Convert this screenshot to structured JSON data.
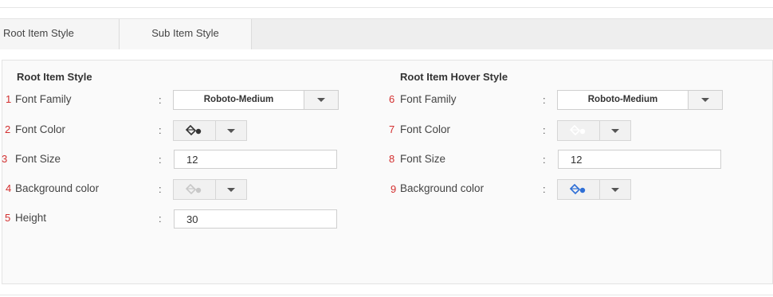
{
  "tabs": [
    {
      "label": "Root Item Style"
    },
    {
      "label": "Sub Item Style"
    }
  ],
  "root_style": {
    "title": "Root Item Style",
    "fields": [
      {
        "num": "1",
        "label": "Font Family",
        "value": "Roboto-Medium"
      },
      {
        "num": "2",
        "label": "Font Color",
        "color": "#333333"
      },
      {
        "num": "3",
        "label": "Font Size",
        "value": "12"
      },
      {
        "num": "4",
        "label": "Background color",
        "color": "#c8c8c8"
      },
      {
        "num": "5",
        "label": "Height",
        "value": "30"
      }
    ]
  },
  "hover_style": {
    "title": "Root Item Hover Style",
    "fields": [
      {
        "num": "6",
        "label": "Font Family",
        "value": "Roboto-Medium"
      },
      {
        "num": "7",
        "label": "Font Color",
        "color": "#ffffff"
      },
      {
        "num": "8",
        "label": "Font Size",
        "value": "12"
      },
      {
        "num": "9",
        "label": "Background color",
        "color": "#2f6fd6"
      }
    ]
  },
  "separator": ":",
  "icons": {
    "color_picker": "paint-bucket-icon",
    "dropdown": "caret-down-icon"
  }
}
